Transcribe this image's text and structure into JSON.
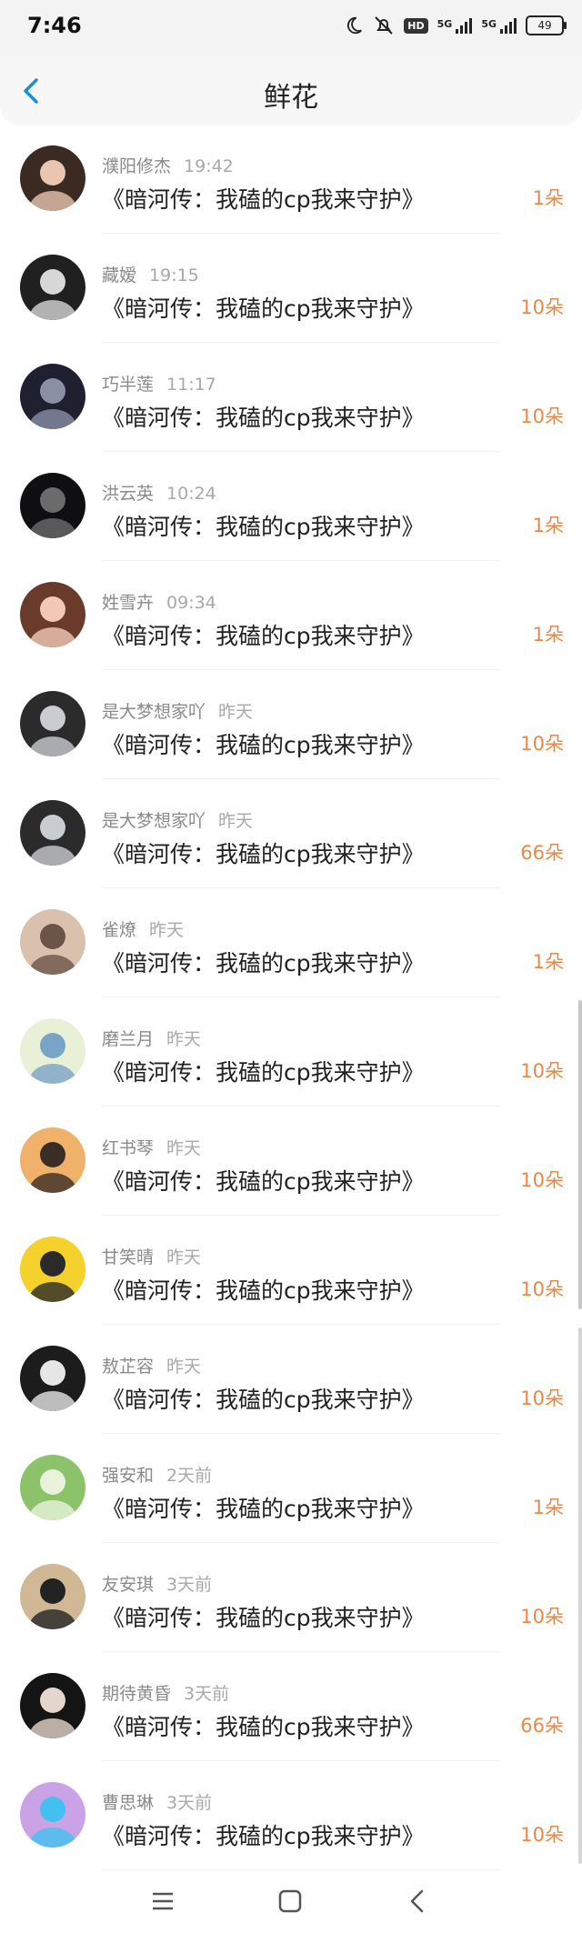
{
  "status_bar": {
    "time": "7:46",
    "network_1": "5G",
    "network_2": "5G",
    "battery": "49",
    "hd_label": "HD"
  },
  "header": {
    "title": "鲜花"
  },
  "items": [
    {
      "name": "濮阳修杰",
      "time": "19:42",
      "title": "《暗河传：我磕的cp我来守护》",
      "count": "1朵"
    },
    {
      "name": "藏嫒",
      "time": "19:15",
      "title": "《暗河传：我磕的cp我来守护》",
      "count": "10朵"
    },
    {
      "name": "巧半莲",
      "time": "11:17",
      "title": "《暗河传：我磕的cp我来守护》",
      "count": "10朵"
    },
    {
      "name": "洪云英",
      "time": "10:24",
      "title": "《暗河传：我磕的cp我来守护》",
      "count": "1朵"
    },
    {
      "name": "姓雪卉",
      "time": "09:34",
      "title": "《暗河传：我磕的cp我来守护》",
      "count": "1朵"
    },
    {
      "name": "是大梦想家吖",
      "time": "昨天",
      "title": "《暗河传：我磕的cp我来守护》",
      "count": "10朵"
    },
    {
      "name": "是大梦想家吖",
      "time": "昨天",
      "title": "《暗河传：我磕的cp我来守护》",
      "count": "66朵"
    },
    {
      "name": "雀燎",
      "time": "昨天",
      "title": "《暗河传：我磕的cp我来守护》",
      "count": "1朵"
    },
    {
      "name": "磨兰月",
      "time": "昨天",
      "title": "《暗河传：我磕的cp我来守护》",
      "count": "10朵"
    },
    {
      "name": "红书琴",
      "time": "昨天",
      "title": "《暗河传：我磕的cp我来守护》",
      "count": "10朵"
    },
    {
      "name": "甘笑晴",
      "time": "昨天",
      "title": "《暗河传：我磕的cp我来守护》",
      "count": "10朵"
    },
    {
      "name": "敖芷容",
      "time": "昨天",
      "title": "《暗河传：我磕的cp我来守护》",
      "count": "10朵"
    },
    {
      "name": "强安和",
      "time": "2天前",
      "title": "《暗河传：我磕的cp我来守护》",
      "count": "1朵"
    },
    {
      "name": "友安琪",
      "time": "3天前",
      "title": "《暗河传：我磕的cp我来守护》",
      "count": "10朵"
    },
    {
      "name": "期待黄昏",
      "time": "3天前",
      "title": "《暗河传：我磕的cp我来守护》",
      "count": "66朵"
    },
    {
      "name": "曹思琳",
      "time": "3天前",
      "title": "《暗河传：我磕的cp我来守护》",
      "count": "10朵"
    }
  ],
  "avatar_icons": [
    "photo-avatar-icon"
  ],
  "colors": {
    "accent": "#1a8fe0",
    "count": "#e8894a"
  }
}
